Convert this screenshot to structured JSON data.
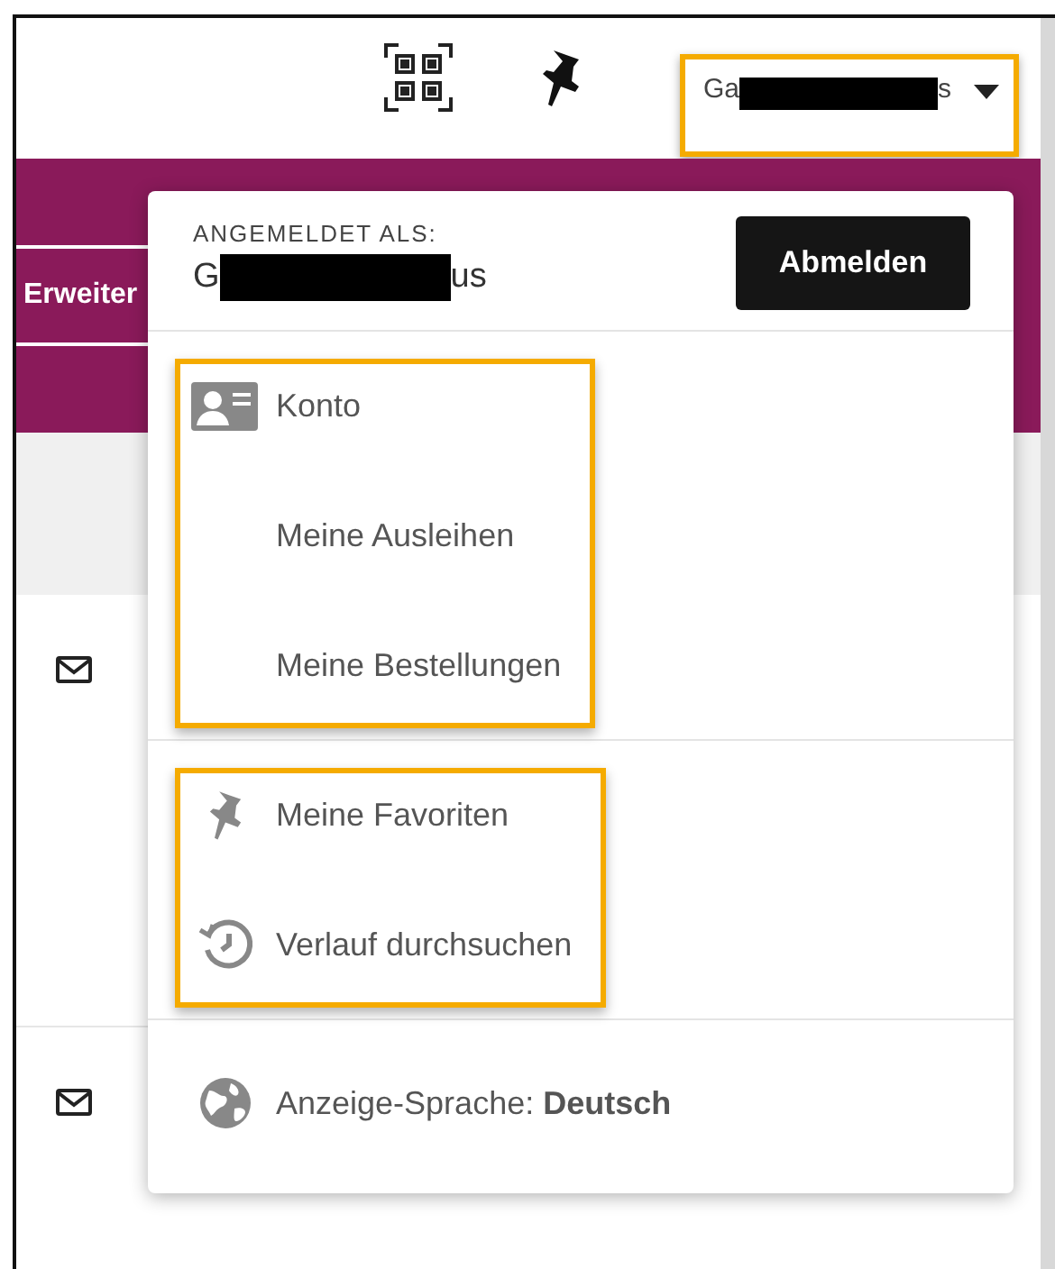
{
  "header": {
    "user_menu": {
      "name_start": "Ga",
      "name_end": "s",
      "expanded": true,
      "highlighted": true
    }
  },
  "nav": {
    "tab": "Erweiter"
  },
  "dropdown": {
    "signed_in_label": "ANGEMELDET ALS:",
    "user_start": "G",
    "user_end": "us",
    "logout_button": "Abmelden",
    "groups": [
      {
        "highlighted": true,
        "items": [
          {
            "label": "Konto",
            "kind": "account"
          },
          {
            "label": "Meine Ausleihen",
            "kind": "plain"
          },
          {
            "label": "Meine Bestellungen",
            "kind": "plain"
          }
        ]
      },
      {
        "highlighted": true,
        "items": [
          {
            "label": "Meine Favoriten",
            "kind": "favorites"
          },
          {
            "label": "Verlauf durchsuchen",
            "kind": "history"
          }
        ]
      },
      {
        "highlighted": false,
        "items": [
          {
            "label": "Anzeige-Sprache: **Deutsch**",
            "kind": "language"
          }
        ]
      }
    ]
  }
}
